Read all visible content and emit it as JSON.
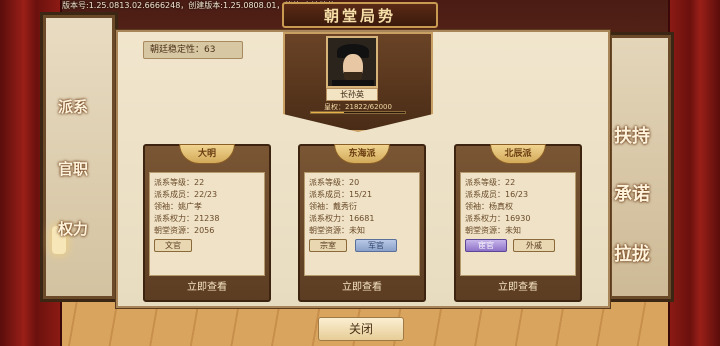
{
  "version_text": "版本号:1.25.0813.02.6666248，创建版本:1.25.0808.01，档位:本地档位",
  "title": "朝堂局势",
  "stability": "朝廷稳定性：63",
  "leader": {
    "name": "长孙英",
    "power_text": "皇权：21822/62000",
    "power": 21822,
    "power_max": 62000
  },
  "left_nav": [
    "派系",
    "官职",
    "权力"
  ],
  "right_nav": [
    "扶持",
    "承诺",
    "拉拢"
  ],
  "factions": [
    {
      "name": "大明",
      "rows": [
        "派系等级：22",
        "派系成员：22/23",
        "领袖：姚广孝",
        "派系权力：21238",
        "朝堂资源：2056"
      ],
      "tags": [
        {
          "label": "文官",
          "style": "plain"
        }
      ],
      "view": "立即查看"
    },
    {
      "name": "东海派",
      "rows": [
        "派系等级：20",
        "派系成员：15/21",
        "领袖：戴秀衍",
        "派系权力：16681",
        "朝堂资源：未知"
      ],
      "tags": [
        {
          "label": "宗室",
          "style": "plain"
        },
        {
          "label": "军官",
          "style": "blue"
        }
      ],
      "view": "立即查看"
    },
    {
      "name": "北辰派",
      "rows": [
        "派系等级：22",
        "派系成员：16/23",
        "领袖：杨真权",
        "派系权力：16930",
        "朝堂资源：未知"
      ],
      "tags": [
        {
          "label": "宦官",
          "style": "purple"
        },
        {
          "label": "外戚",
          "style": "plain"
        }
      ],
      "view": "立即查看"
    }
  ],
  "close_label": "关闭"
}
